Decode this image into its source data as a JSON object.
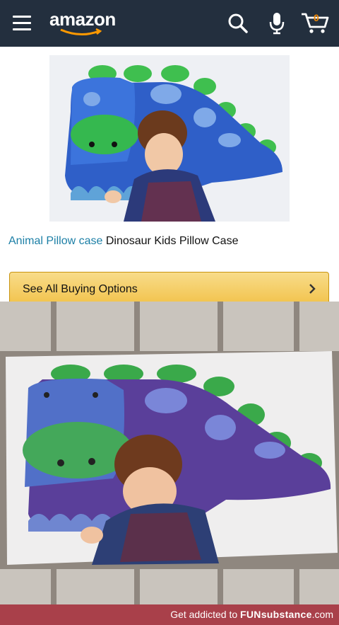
{
  "header": {
    "logo_text": "amazon",
    "cart_count": "0"
  },
  "product": {
    "title_link": "Animal Pillow case",
    "title_rest": " Dinosaur Kids Pillow Case"
  },
  "buy_options": {
    "label": "See All Buying Options"
  },
  "footer": {
    "prefix": "Get addicted to ",
    "brand": "FUNsubstance",
    "suffix": ".com"
  },
  "colors": {
    "header_bg": "#232f3e",
    "link": "#1c7fa6",
    "button": "#f2c34d",
    "footer_bg": "#a9404a"
  }
}
